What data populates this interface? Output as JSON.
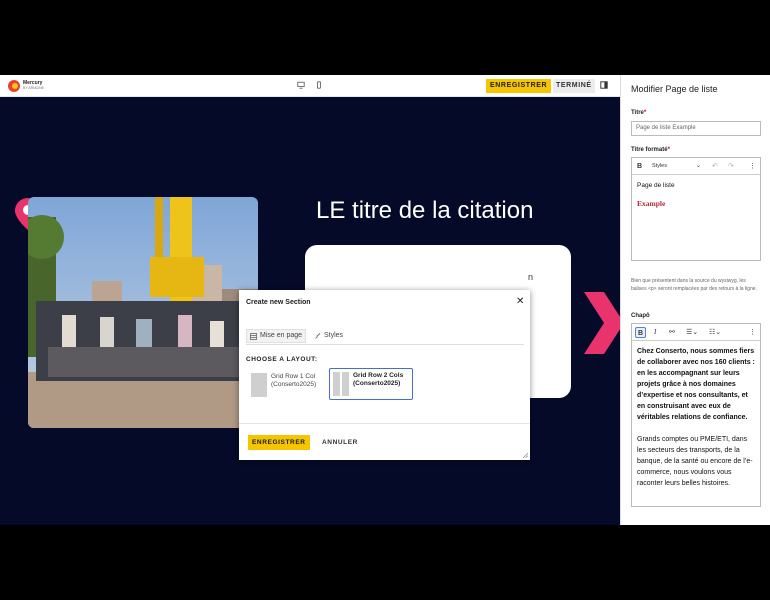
{
  "app": {
    "logo_name": "Mercury",
    "logo_sub": "BY ARIADNE"
  },
  "topbar": {
    "save_label": "ENREGISTRER",
    "done_label": "TERMINÉ"
  },
  "canvas": {
    "quote_title": "LE titre de la citation",
    "card_visible_text": "n"
  },
  "sidebar": {
    "title": "Modifier Page de liste",
    "titre_label": "Titre",
    "titre_value": "Page de liste Example",
    "titre_formate_label": "Titre formaté",
    "styles_label": "Styles",
    "tf_line1": "Page de liste",
    "tf_line2": "Example",
    "help_text": "Bien que présentent dans la source du wysiwyg, les balises <p> seront remplacées par des retours à la ligne.",
    "chapo_label": "Chapô",
    "chapo_bold_1": "Chez Conserto, nous sommes fiers de collaborer avec nos 160 clients :",
    "chapo_bold_2": "en les accompagnant sur leurs projets grâce à nos domaines d’expertise et nos consultants, et en construisant avec eux de véritables relations de confiance.",
    "chapo_normal": "Grands comptes ou PME/ETI, dans les secteurs des transports, de la banque, de la santé ou encore de l’e-commerce, nous voulons vous raconter leurs belles histoires."
  },
  "modal": {
    "title": "Create new Section",
    "tab_layout": "Mise en page",
    "tab_styles": "Styles",
    "choose_label": "CHOOSE A LAYOUT:",
    "option1": "Grid Row 1 Col (Conserto2025)",
    "option2": "Grid Row 2 Cols (Conserto2025)",
    "save_label": "ENREGISTRER",
    "cancel_label": "ANNULER"
  },
  "colors": {
    "accent_yellow": "#f5c500",
    "canvas_navy": "#050a28",
    "brand_pink": "#e8336d",
    "selection_blue": "#4a6bd6"
  },
  "icons": [
    "logo-icon",
    "desktop-icon",
    "mobile-icon",
    "panel-toggle-icon",
    "location-pin-icon",
    "chevron-right-icon",
    "close-icon",
    "layout-icon",
    "styles-icon",
    "bold-icon",
    "italic-icon",
    "link-icon",
    "bullet-list-icon",
    "numbered-list-icon",
    "undo-icon",
    "redo-icon",
    "more-icon",
    "resize-handle-icon"
  ]
}
